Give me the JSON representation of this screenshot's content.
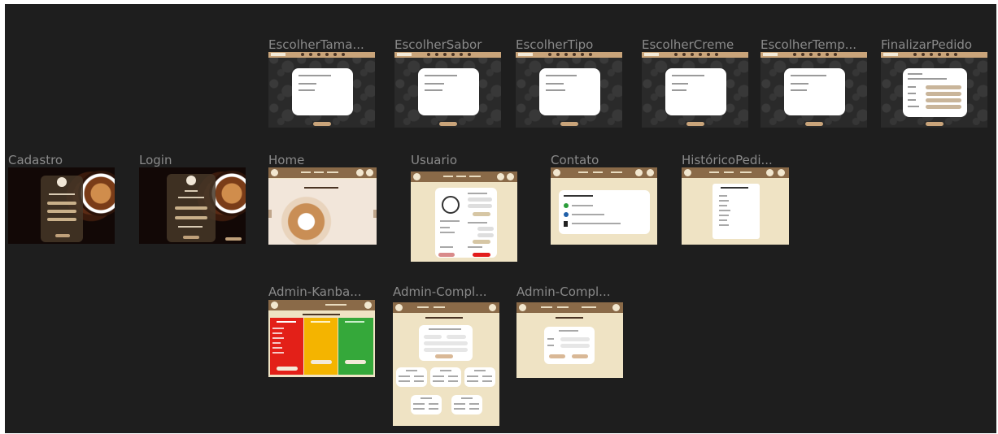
{
  "frames": {
    "escolher_tamanho": "EscolherTama...",
    "escolher_sabor": "EscolherSabor",
    "escolher_tipo": "EscolherTipo",
    "escolher_creme": "EscolherCreme",
    "escolher_temp": "EscolherTemp...",
    "finalizar_pedido": "FinalizarPedido",
    "cadastro": "Cadastro",
    "login": "Login",
    "home": "Home",
    "usuario": "Usuario",
    "contato": "Contato",
    "historico": "HistóricoPedi...",
    "admin_kanban": "Admin-Kanba...",
    "admin_compl_1": "Admin-Compl...",
    "admin_compl_2": "Admin-Compl..."
  },
  "colors": {
    "canvas": "#1e1e1e",
    "label": "#8a8a8a",
    "cream": "#efe3c4",
    "brown": "#8a6a48",
    "gold": "#c9a47a",
    "kanban_red": "#e32018",
    "kanban_yellow": "#f4b400",
    "kanban_green": "#35a83a"
  },
  "icons": [
    "logo-icon",
    "cart-icon",
    "profile-icon",
    "user-avatar-icon",
    "phone-icon",
    "email-icon",
    "location-icon"
  ]
}
